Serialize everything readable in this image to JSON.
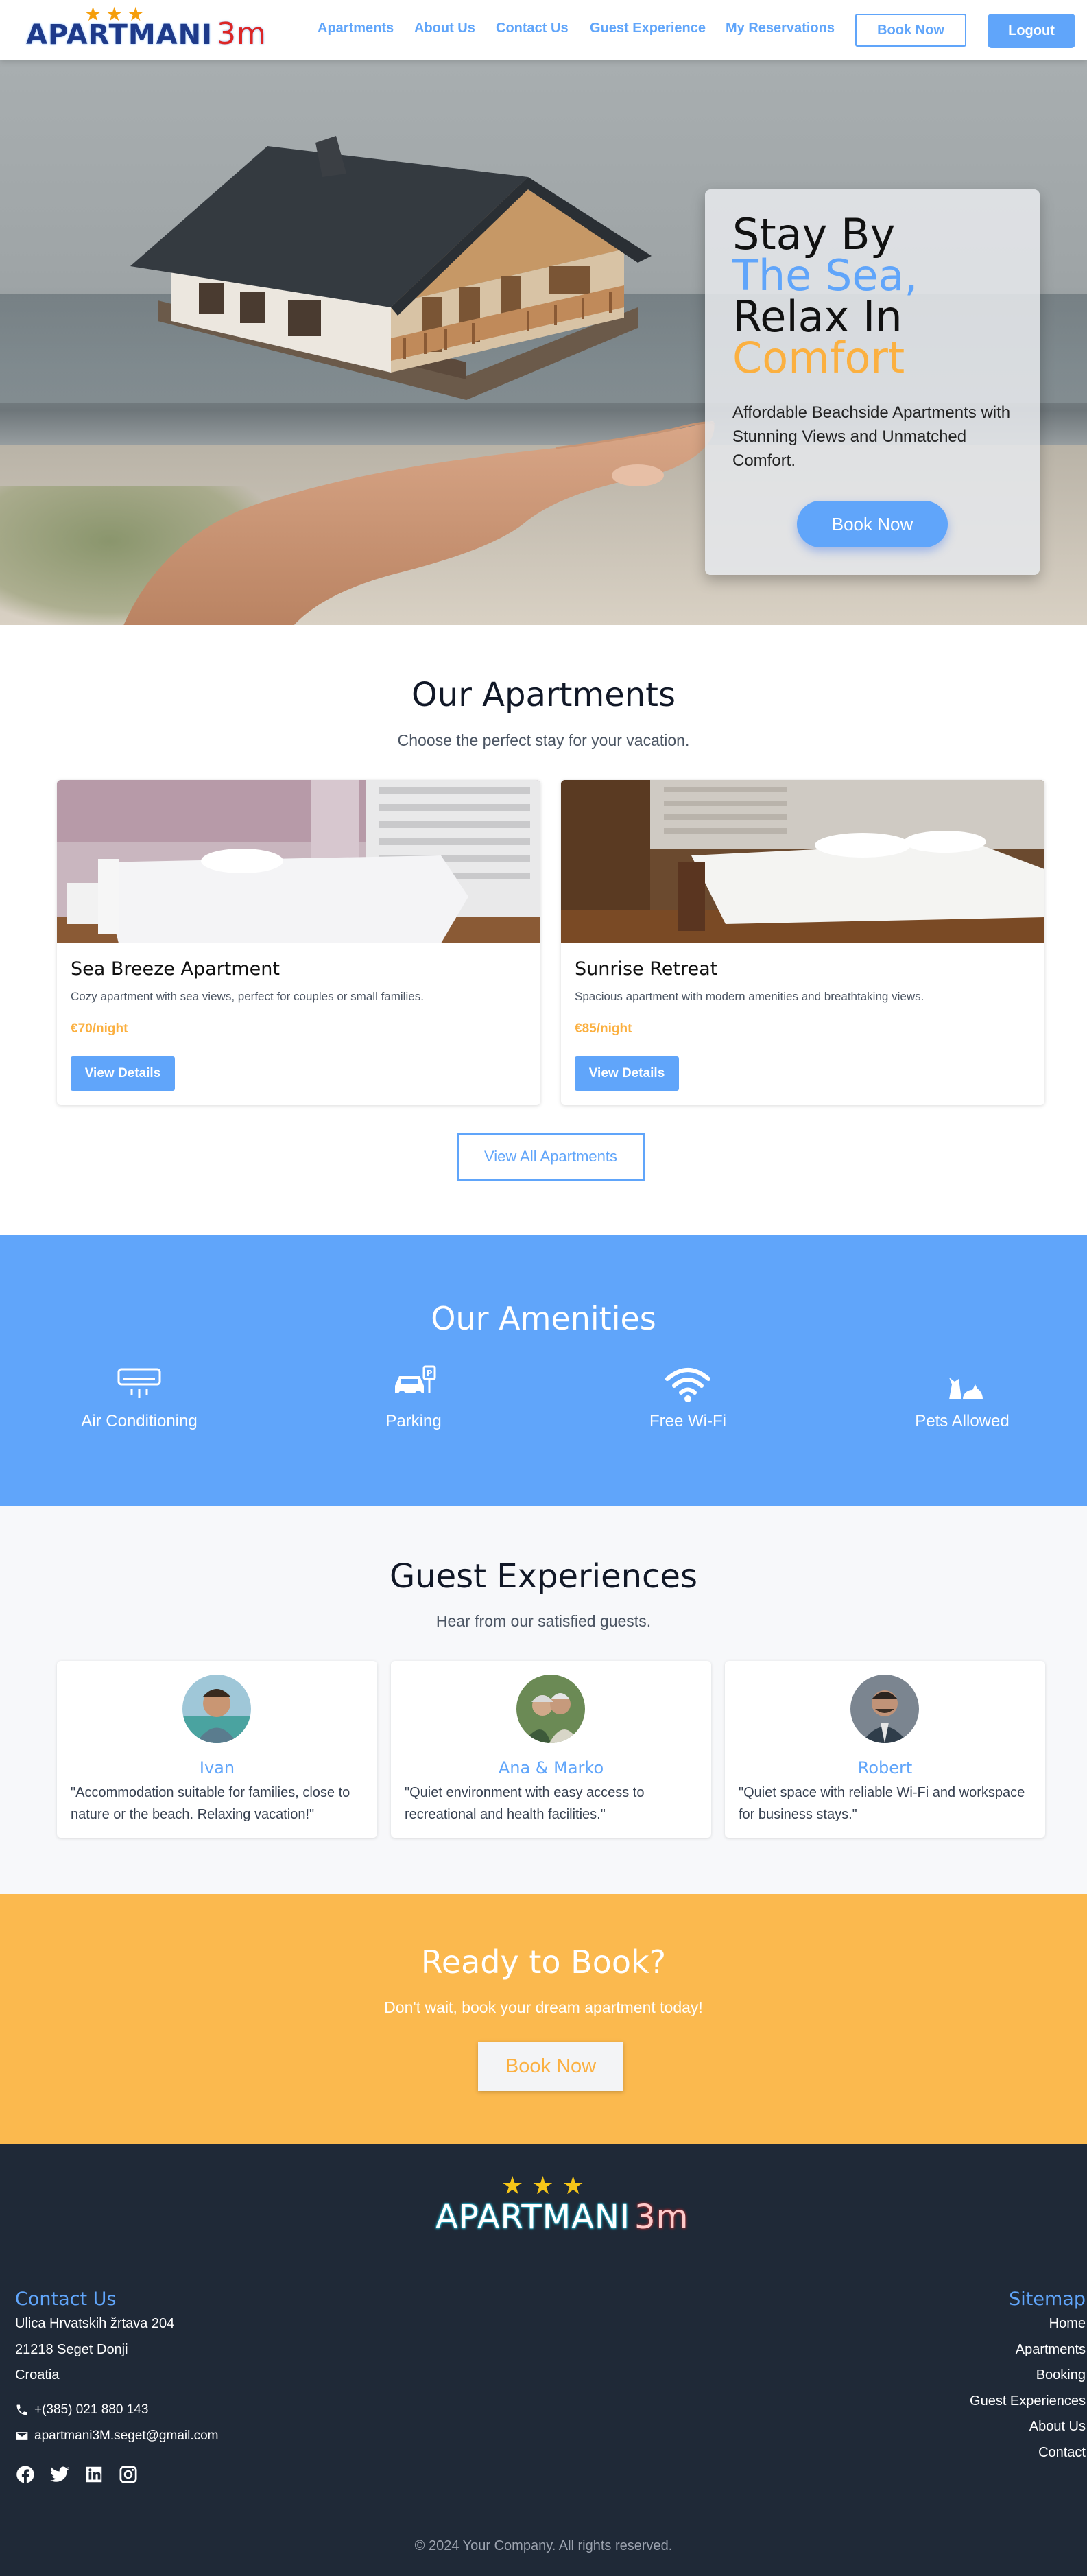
{
  "nav": {
    "logo_text": "APARTMANI",
    "logo_suffix": "3m",
    "logo_stars": "★★★",
    "links": [
      "Apartments",
      "About Us",
      "Contact Us",
      "Guest Experience",
      "My Reservations"
    ],
    "book_now": "Book Now",
    "logout": "Logout"
  },
  "hero": {
    "title_line1": "Stay By",
    "title_line2": "The Sea,",
    "title_line3": "Relax In",
    "title_line4": "Comfort",
    "subtitle": "Affordable Beachside Apartments with Stunning Views and Unmatched Comfort.",
    "cta": "Book Now"
  },
  "apartments": {
    "title": "Our Apartments",
    "subtitle": "Choose the perfect stay for your vacation.",
    "items": [
      {
        "name": "Sea Breeze Apartment",
        "description": "Cozy apartment with sea views, perfect for couples or small families.",
        "price": "€70/night",
        "button": "View Details"
      },
      {
        "name": "Sunrise Retreat",
        "description": "Spacious apartment with modern amenities and breathtaking views.",
        "price": "€85/night",
        "button": "View Details"
      }
    ],
    "view_all": "View All Apartments"
  },
  "amenities": {
    "title": "Our Amenities",
    "items": [
      {
        "label": "Air Conditioning",
        "icon": "air-conditioner-icon"
      },
      {
        "label": "Parking",
        "icon": "parking-car-icon"
      },
      {
        "label": "Free Wi-Fi",
        "icon": "wifi-icon"
      },
      {
        "label": "Pets Allowed",
        "icon": "pets-icon"
      }
    ]
  },
  "guests": {
    "title": "Guest Experiences",
    "subtitle": "Hear from our satisfied guests.",
    "items": [
      {
        "name": "Ivan",
        "quote": "\"Accommodation suitable for families, close to nature or the beach. Relaxing vacation!\""
      },
      {
        "name": "Ana & Marko",
        "quote": "\"Quiet environment with easy access to recreational and health facilities.\""
      },
      {
        "name": "Robert",
        "quote": "\"Quiet space with reliable Wi-Fi and workspace for business stays.\""
      }
    ]
  },
  "ready": {
    "title": "Ready to Book?",
    "subtitle": "Don't wait, book your dream apartment today!",
    "button": "Book Now"
  },
  "footer": {
    "contact_title": "Contact Us",
    "address1": "Ulica Hrvatskih žrtava 204",
    "address2": "21218 Seget Donji",
    "country": "Croatia",
    "phone": "+(385) 021 880 143",
    "email": "apartmani3M.seget@gmail.com",
    "sitemap_title": "Sitemap",
    "sitemap": [
      "Home",
      "Apartments",
      "Booking",
      "Guest Experiences",
      "About Us",
      "Contact"
    ],
    "copyright": "© 2024 Your Company. All rights reserved."
  },
  "colors": {
    "primary": "#60a5fa",
    "accent": "#fbb040",
    "footer_bg": "#1f2937"
  }
}
